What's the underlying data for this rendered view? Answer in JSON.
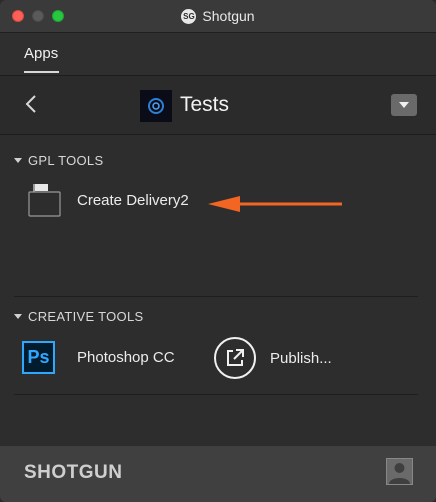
{
  "window": {
    "title": "Shotgun",
    "logo_text": "SG"
  },
  "tabs": [
    {
      "label": "Apps",
      "active": true
    }
  ],
  "header": {
    "project_name": "Tests"
  },
  "sections": [
    {
      "title": "GPL TOOLS",
      "items": [
        {
          "label": "Create Delivery2",
          "icon": "folder-icon"
        }
      ]
    },
    {
      "title": "CREATIVE TOOLS",
      "items": [
        {
          "label": "Photoshop CC",
          "icon": "photoshop-icon",
          "icon_text": "Ps"
        },
        {
          "label": "Publish...",
          "icon": "publish-icon"
        }
      ]
    }
  ],
  "footer": {
    "brand": "SHOTGUN"
  },
  "annotation": {
    "arrow_color": "#f26522"
  },
  "colors": {
    "photoshop_blue": "#31a8ff",
    "background": "#2d2d2d"
  }
}
